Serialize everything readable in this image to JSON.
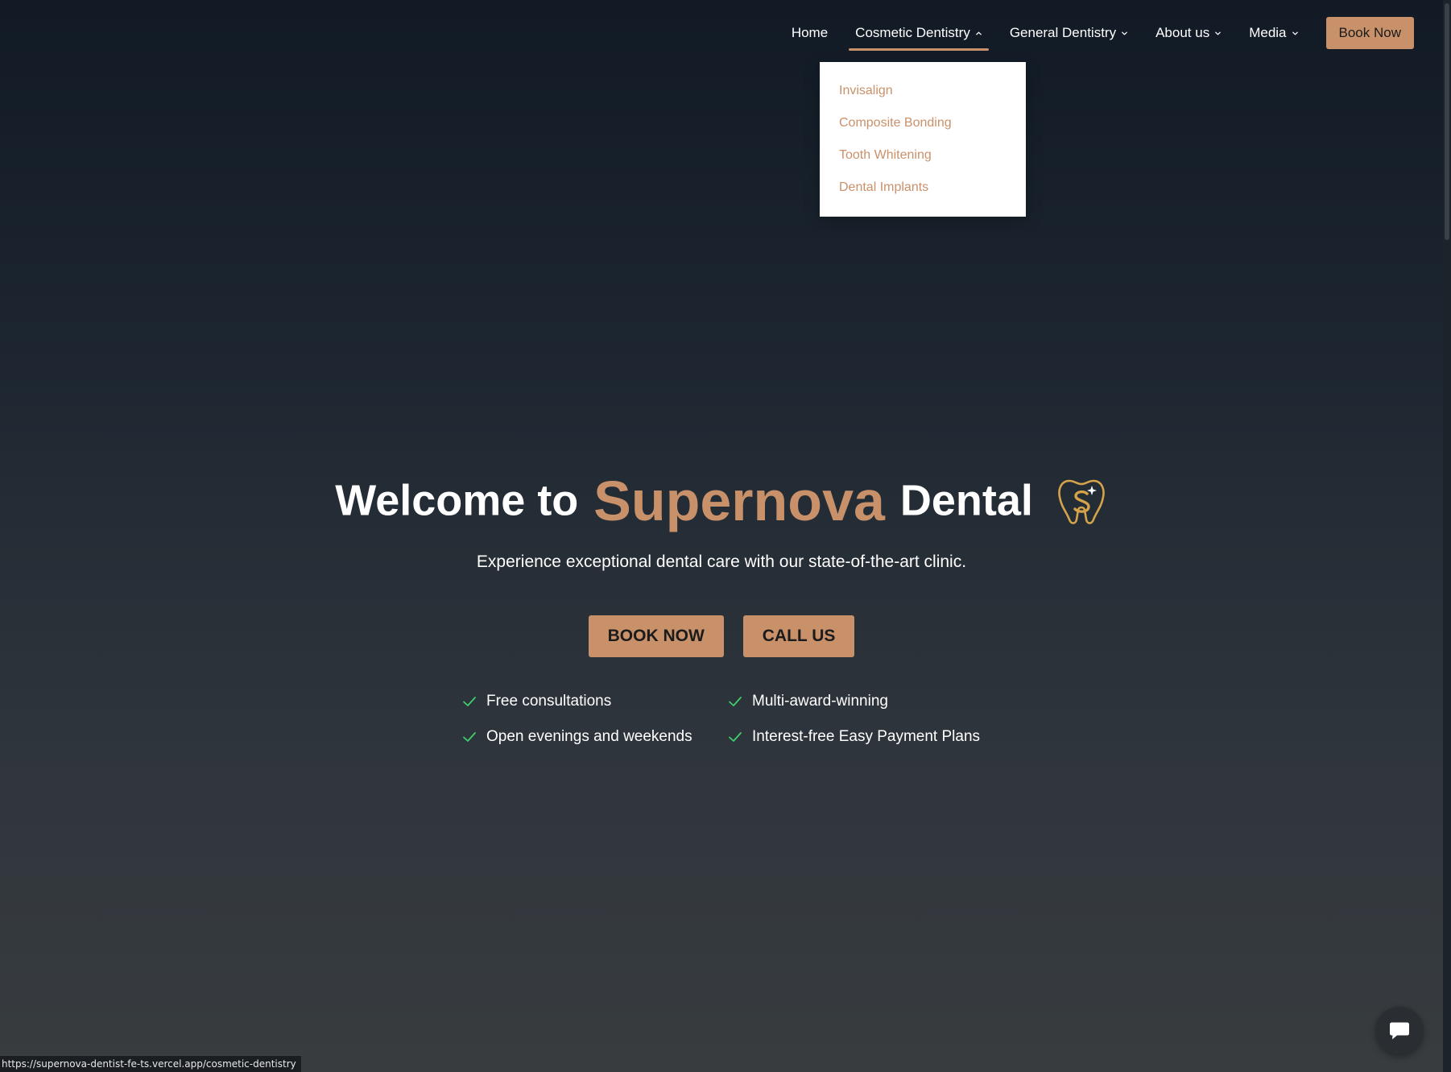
{
  "nav": {
    "items": [
      {
        "label": "Home"
      },
      {
        "label": "Cosmetic Dentistry"
      },
      {
        "label": "General Dentistry"
      },
      {
        "label": "About us"
      },
      {
        "label": "Media"
      }
    ],
    "book_label": "Book Now"
  },
  "dropdown": {
    "items": [
      {
        "label": "Invisalign"
      },
      {
        "label": "Composite Bonding"
      },
      {
        "label": "Tooth Whitening"
      },
      {
        "label": "Dental Implants"
      }
    ]
  },
  "hero": {
    "title_prefix": "Welcome to",
    "brand": "Supernova",
    "title_suffix": "Dental",
    "subtitle": "Experience exceptional dental care with our state-of-the-art clinic.",
    "book_label": "BOOK NOW",
    "call_label": "CALL US"
  },
  "features": [
    {
      "label": "Free consultations"
    },
    {
      "label": "Multi-award-winning"
    },
    {
      "label": "Open evenings and weekends"
    },
    {
      "label": "Interest-free Easy Payment Plans"
    }
  ],
  "status_bar": {
    "url": "https://supernova-dentist-fe-ts.vercel.app/cosmetic-dentistry"
  },
  "colors": {
    "accent": "#c9916a",
    "check": "#3ecf6b",
    "logo_gold": "#d4a34a"
  },
  "icons": {
    "logo": "tooth-logo-icon",
    "check": "check-icon",
    "chevron": "chevron-down-icon",
    "chevron_open": "chevron-up-icon",
    "chat": "chat-icon"
  }
}
